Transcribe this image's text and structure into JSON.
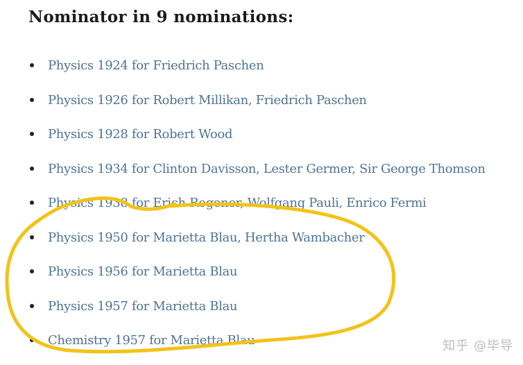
{
  "heading": "Nominator in 9 nominations:",
  "nominations": [
    {
      "text": "Physics 1924 for Friedrich Paschen"
    },
    {
      "text": "Physics 1926 for Robert Millikan, Friedrich Paschen"
    },
    {
      "text": "Physics 1928 for Robert Wood"
    },
    {
      "text": "Physics 1934 for Clinton Davisson, Lester Germer, Sir George Thomson"
    },
    {
      "text": "Physics 1938 for Erich Regener, Wolfgang Pauli, Enrico Fermi"
    },
    {
      "text": "Physics 1950 for Marietta Blau, Hertha Wambacher"
    },
    {
      "text": "Physics 1956 for Marietta Blau"
    },
    {
      "text": "Physics 1957 for Marietta Blau"
    },
    {
      "text": "Chemistry 1957 for Marietta Blau"
    }
  ],
  "watermark": "知乎 @毕导",
  "colors": {
    "link": "#4f7393",
    "heading": "#1b1b1b",
    "highlight": "#f2c318",
    "watermark": "#bdbdbd"
  }
}
